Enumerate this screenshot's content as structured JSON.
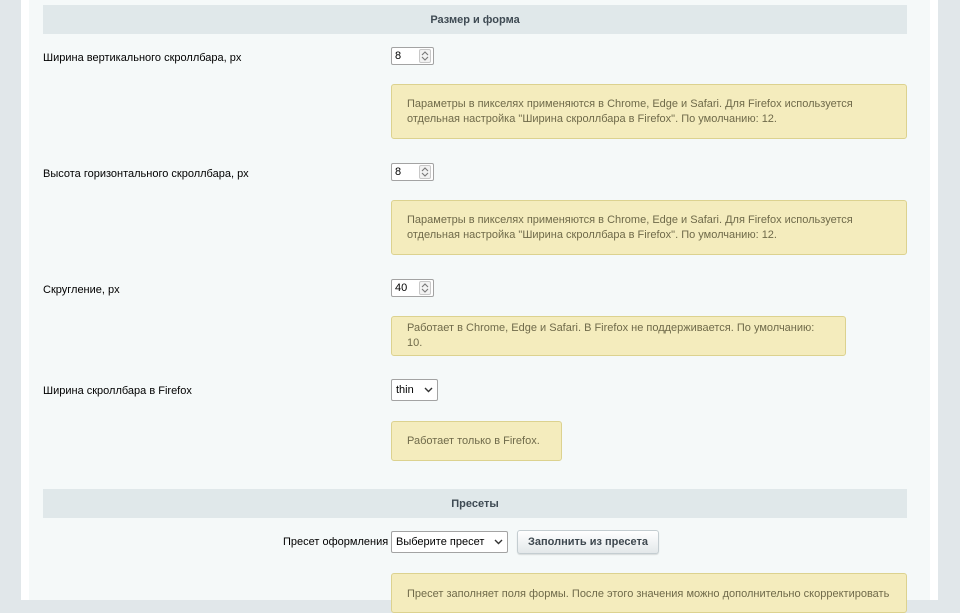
{
  "sections": {
    "size_shape_title": "Размер и форма",
    "presets_title": "Пресеты"
  },
  "fields": {
    "vertical_width": {
      "label": "Ширина вертикального скроллбара, px",
      "value": "8",
      "note": "Параметры в пикселях применяются в Chrome, Edge и Safari. Для Firefox используется отдельная настройка \"Ширина скроллбара в Firefox\". По умолчанию: 12."
    },
    "horizontal_height": {
      "label": "Высота горизонтального скроллбара, px",
      "value": "8",
      "note": "Параметры в пикселях применяются в Chrome, Edge и Safari. Для Firefox используется отдельная настройка \"Ширина скроллбара в Firefox\". По умолчанию: 12."
    },
    "rounding": {
      "label": "Скругление, px",
      "value": "40",
      "note": "Работает в Chrome, Edge и Safari. В Firefox не поддерживается. По умолчанию: 10."
    },
    "firefox_width": {
      "label": "Ширина скроллбара в Firefox",
      "value": "thin",
      "note": "Работает только в Firefox."
    },
    "preset": {
      "label": "Пресет оформления",
      "value": "Выберите пресет",
      "button": "Заполнить из пресета",
      "note": "Пресет заполняет поля формы. После этого значения можно дополнительно скорректировать"
    }
  },
  "icons": {
    "spinner": "spinner-arrows-icon",
    "dropdown": "chevron-down-icon"
  },
  "colors": {
    "section_header_bg": "#e0e8ea",
    "note_bg": "#f4ecbd",
    "note_border": "#dcd28f",
    "page_bg": "#f5f9f9"
  }
}
